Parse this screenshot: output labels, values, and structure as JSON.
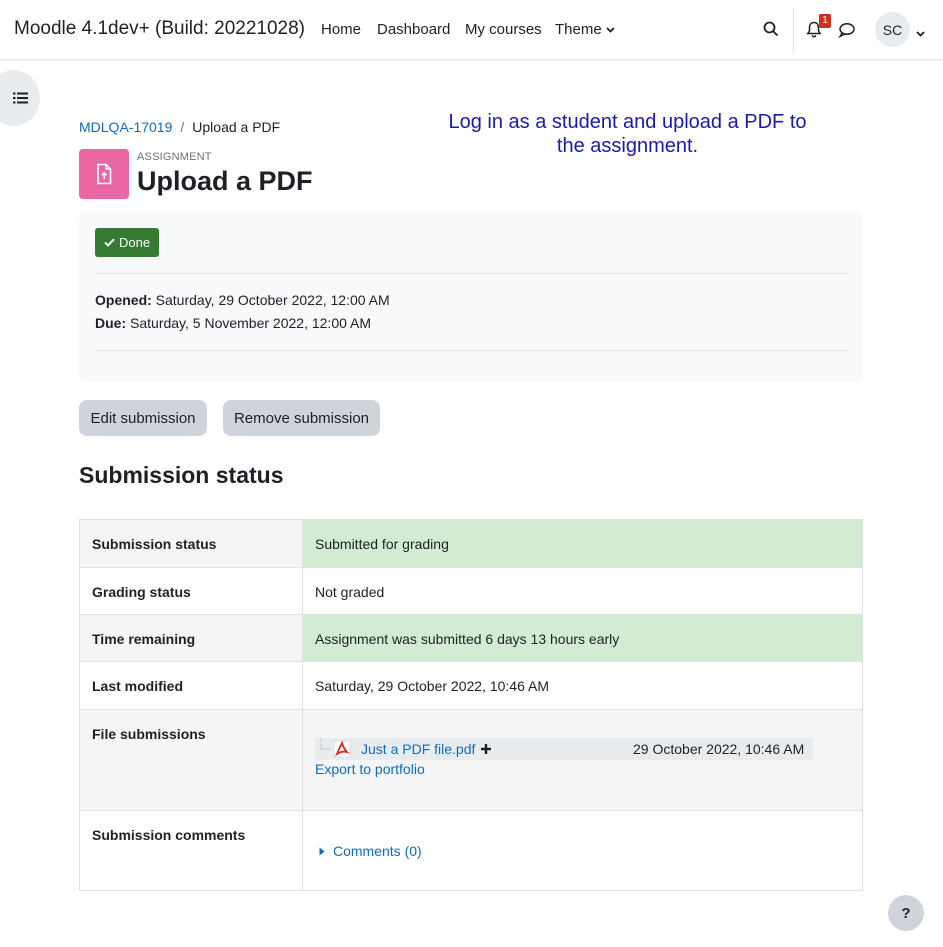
{
  "navbar": {
    "brand": "Moodle 4.1dev+ (Build: 20221028)",
    "links": [
      "Home",
      "Dashboard",
      "My courses",
      "Theme"
    ],
    "notification_count": "1",
    "avatar_initials": "SC"
  },
  "breadcrumb": {
    "course": "MDLQA-17019",
    "current": "Upload a PDF"
  },
  "note": "Log in as a student and upload a PDF to the assignment.",
  "header": {
    "activity_type": "ASSIGNMENT",
    "title": "Upload a PDF"
  },
  "activity_info": {
    "completion_label": "Done",
    "opened_label": "Opened:",
    "opened_value": "Saturday, 29 October 2022, 12:00 AM",
    "due_label": "Due:",
    "due_value": "Saturday, 5 November 2022, 12:00 AM"
  },
  "actions": {
    "edit_label": "Edit submission",
    "remove_label": "Remove submission"
  },
  "status_section": {
    "heading": "Submission status",
    "rows": [
      {
        "label": "Submission status",
        "value": "Submitted for grading"
      },
      {
        "label": "Grading status",
        "value": "Not graded"
      },
      {
        "label": "Time remaining",
        "value": "Assignment was submitted 6 days 13 hours early"
      },
      {
        "label": "Last modified",
        "value": "Saturday, 29 October 2022, 10:46 AM"
      },
      {
        "label": "File submissions",
        "file_name": "Just a PDF file.pdf",
        "file_date": "29 October 2022, 10:46 AM",
        "export_label": "Export to portfolio"
      },
      {
        "label": "Submission comments",
        "comments_label": "Comments (0)"
      }
    ]
  },
  "help": {
    "label": "?"
  },
  "colors": {
    "success_bg": "#d1ecd2",
    "done_badge": "#357a32",
    "activity_icon": "#eb66a2",
    "link": "#0f6cbf",
    "note": "#1a1ab0"
  }
}
